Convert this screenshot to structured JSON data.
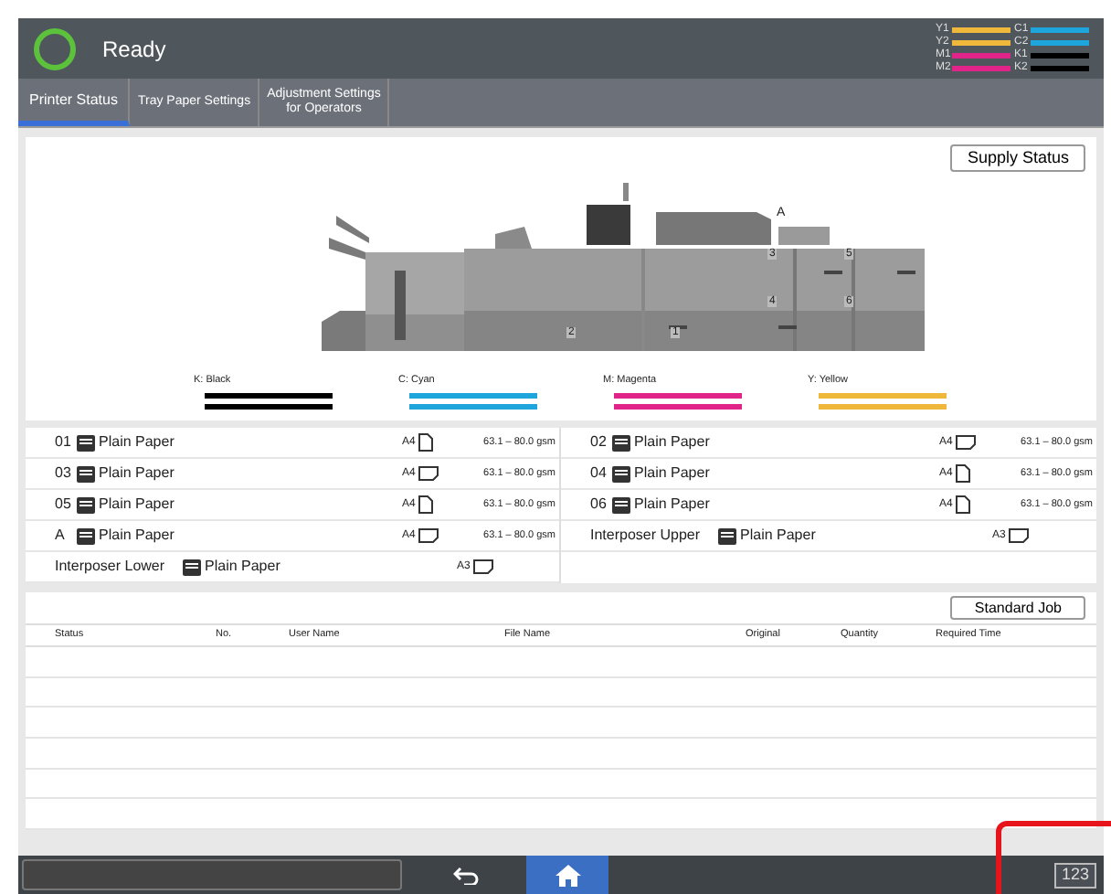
{
  "header": {
    "status": "Ready",
    "toner": [
      {
        "label": "Y1",
        "color": "#f0b83a",
        "level": 1
      },
      {
        "label": "C1",
        "color": "#1ea5dc",
        "level": 1
      },
      {
        "label": "Y2",
        "color": "#f0b83a",
        "level": 1
      },
      {
        "label": "C2",
        "color": "#1ea5dc",
        "level": 1
      },
      {
        "label": "M1",
        "color": "#e0248a",
        "level": 1
      },
      {
        "label": "K1",
        "color": "#000000",
        "level": 1
      },
      {
        "label": "M2",
        "color": "#e0248a",
        "level": 1
      },
      {
        "label": "K2",
        "color": "#000000",
        "level": 1
      }
    ]
  },
  "tabs": [
    {
      "label": "Printer Status",
      "selected": true
    },
    {
      "label": "Tray Paper Settings",
      "selected": false
    },
    {
      "label": "Adjustment Settings\nfor Operators",
      "selected": false
    }
  ],
  "supply_button": "Supply Status",
  "machine_labels": [
    "A",
    "3",
    "5",
    "4",
    "6",
    "2",
    "1"
  ],
  "toners": [
    {
      "label": "K: Black",
      "color": "#000000",
      "bars": [
        {
          "level": 1
        },
        {
          "level": 1
        }
      ]
    },
    {
      "label": "C: Cyan",
      "color": "#1ea5dc",
      "bars": [
        {
          "level": 1
        },
        {
          "level": 1
        }
      ]
    },
    {
      "label": "M: Magenta",
      "color": "#e0248a",
      "bars": [
        {
          "level": 1
        },
        {
          "level": 1
        }
      ]
    },
    {
      "label": "Y: Yellow",
      "color": "#f0b83a",
      "bars": [
        {
          "level": 1
        },
        {
          "level": 1
        }
      ]
    }
  ],
  "trays": [
    [
      {
        "tray": "01",
        "paper": "Plain Paper",
        "size": "A4",
        "kind": "portrait",
        "weight": "63.1 – 80.0 gsm"
      },
      {
        "tray": "03",
        "paper": "Plain Paper",
        "size": "A4",
        "kind": "landscape",
        "weight": "63.1 – 80.0 gsm"
      },
      {
        "tray": "05",
        "paper": "Plain Paper",
        "size": "A4",
        "kind": "portrait",
        "weight": "63.1 – 80.0 gsm"
      },
      {
        "tray": "A",
        "paper": "Plain Paper",
        "size": "A4",
        "kind": "landscape",
        "weight": "63.1 – 80.0 gsm"
      },
      {
        "tray": "Interposer Lower",
        "paper": "Plain Paper",
        "size": "A3",
        "kind": "landscape"
      }
    ],
    [
      {
        "tray": "02",
        "paper": "Plain Paper",
        "size": "A4",
        "kind": "landscape",
        "weight": "63.1 – 80.0 gsm"
      },
      {
        "tray": "04",
        "paper": "Plain Paper",
        "size": "A4",
        "kind": "portrait",
        "weight": "63.1 – 80.0 gsm"
      },
      {
        "tray": "06",
        "paper": "Plain Paper",
        "size": "A4",
        "kind": "portrait",
        "weight": "63.1 – 80.0 gsm"
      },
      {
        "tray": "Interposer Upper",
        "paper": "Plain Paper",
        "size": "A3",
        "kind": "landscape"
      }
    ]
  ],
  "job_button": "Standard Job",
  "job_table": {
    "columns": [
      "Status",
      "No.",
      "User Name",
      "File Name",
      "Original",
      "Quantity",
      "Required Time"
    ]
  },
  "bottom_bar": {
    "keypad": "123"
  }
}
